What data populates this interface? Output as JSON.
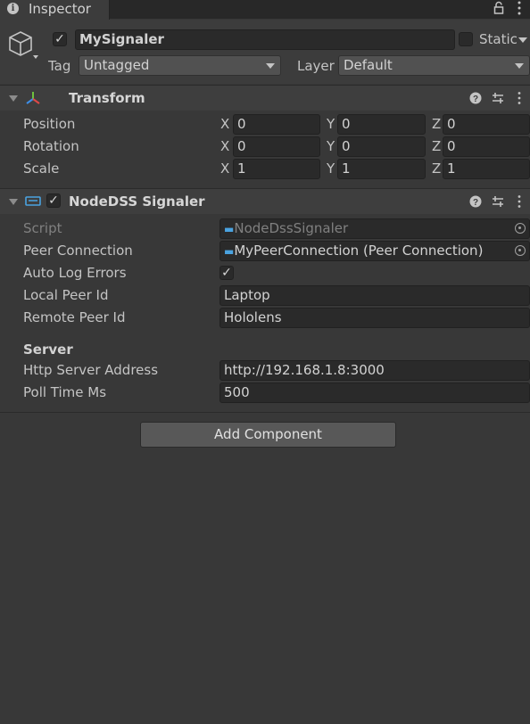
{
  "window": {
    "tab_title": "Inspector"
  },
  "header": {
    "object_name": "MySignaler",
    "active": true,
    "static_label": "Static",
    "static_checked": false,
    "tag_label": "Tag",
    "tag_value": "Untagged",
    "layer_label": "Layer",
    "layer_value": "Default"
  },
  "transform": {
    "title": "Transform",
    "rows": [
      {
        "label": "Position",
        "x": "0",
        "y": "0",
        "z": "0"
      },
      {
        "label": "Rotation",
        "x": "0",
        "y": "0",
        "z": "0"
      },
      {
        "label": "Scale",
        "x": "1",
        "y": "1",
        "z": "1"
      }
    ],
    "axis_x": "X",
    "axis_y": "Y",
    "axis_z": "Z"
  },
  "signaler": {
    "title": "NodeDSS Signaler",
    "enabled": true,
    "script_label": "Script",
    "script_value": "NodeDssSignaler",
    "peer_connection_label": "Peer Connection",
    "peer_connection_value": "MyPeerConnection (Peer Connection)",
    "auto_log_errors_label": "Auto Log Errors",
    "auto_log_errors": true,
    "local_peer_id_label": "Local Peer Id",
    "local_peer_id": "Laptop",
    "remote_peer_id_label": "Remote Peer Id",
    "remote_peer_id": "Hololens",
    "server_header": "Server",
    "http_server_address_label": "Http Server Address",
    "http_server_address": "http://192.168.1.8:3000",
    "poll_time_ms_label": "Poll Time Ms",
    "poll_time_ms": "500"
  },
  "footer": {
    "add_component_label": "Add Component"
  },
  "icons": [
    "info-icon",
    "lock-icon",
    "kebab-menu-icon",
    "gameobject-cube-icon",
    "transform-axes-icon",
    "help-icon",
    "preset-icon",
    "script-icon"
  ]
}
